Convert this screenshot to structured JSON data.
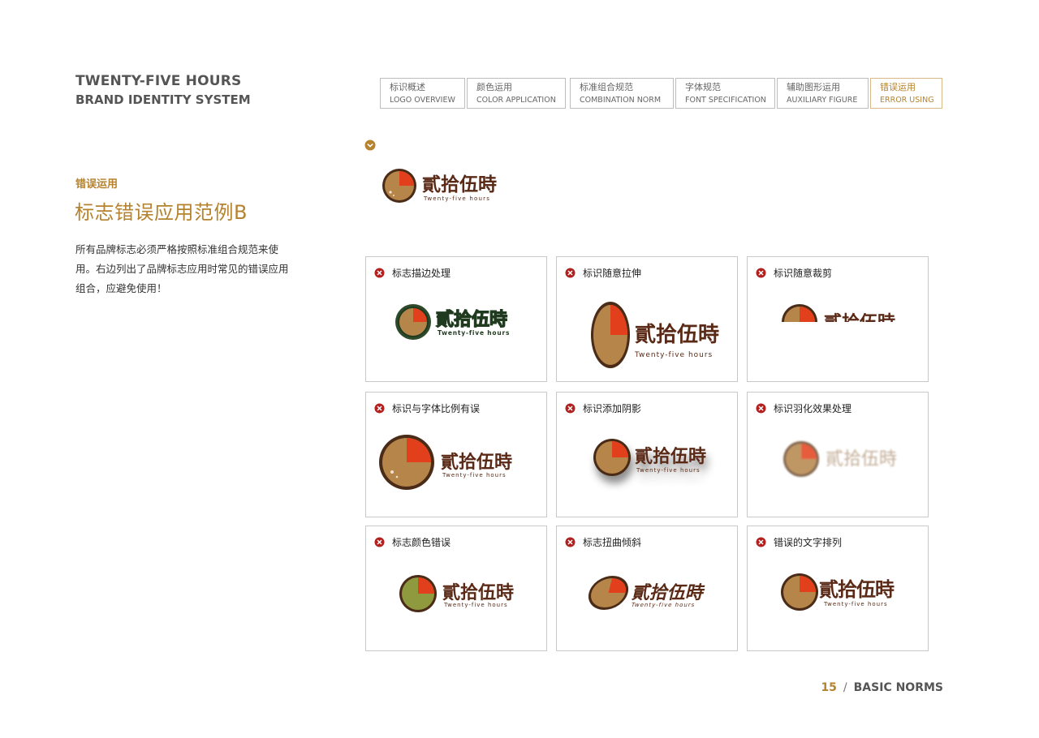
{
  "brand": {
    "line1": "TWENTY-FIVE HOURS",
    "line2": "BRAND IDENTITY SYSTEM"
  },
  "nav": [
    {
      "cn": "标识概述",
      "en": "LOGO OVERVIEW",
      "active": false
    },
    {
      "cn": "颜色运用",
      "en": "COLOR APPLICATION",
      "active": false
    },
    {
      "cn": "标准组合规范",
      "en": "COMBINATION NORM",
      "active": false
    },
    {
      "cn": "字体规范",
      "en": "FONT SPECIFICATION",
      "active": false
    },
    {
      "cn": "辅助图形运用",
      "en": "AUXILIARY FIGURE",
      "active": false
    },
    {
      "cn": "错误运用",
      "en": "ERROR USING",
      "active": true
    }
  ],
  "section": {
    "tag": "错误运用",
    "heading": "标志错误应用范例B",
    "body": "所有品牌标志必须严格按照标准组合规范来使用。右边列出了品牌标志应用时常见的错误应用组合，应避免使用！"
  },
  "logo": {
    "wordmark": "貳拾伍時",
    "tagline": "Twenty-five hours"
  },
  "colors": {
    "accent": "#b5832f",
    "clock_face": "#b5854a",
    "clock_ring": "#4a2b17",
    "clock_slice": "#e2401c",
    "error_red": "#b0211f"
  },
  "icons": {
    "ok": "check-circle-icon",
    "error": "x-circle-icon"
  },
  "errors": [
    {
      "label": "标志描边处理"
    },
    {
      "label": "标识随意拉伸"
    },
    {
      "label": "标识随意裁剪"
    },
    {
      "label": "标识与字体比例有误"
    },
    {
      "label": "标识添加阴影"
    },
    {
      "label": "标识羽化效果处理"
    },
    {
      "label": "标志颜色错误"
    },
    {
      "label": "标志扭曲倾斜"
    },
    {
      "label": "错误的文字排列"
    }
  ],
  "footer": {
    "page": "15",
    "separator": "/",
    "section": "BASIC NORMS"
  }
}
